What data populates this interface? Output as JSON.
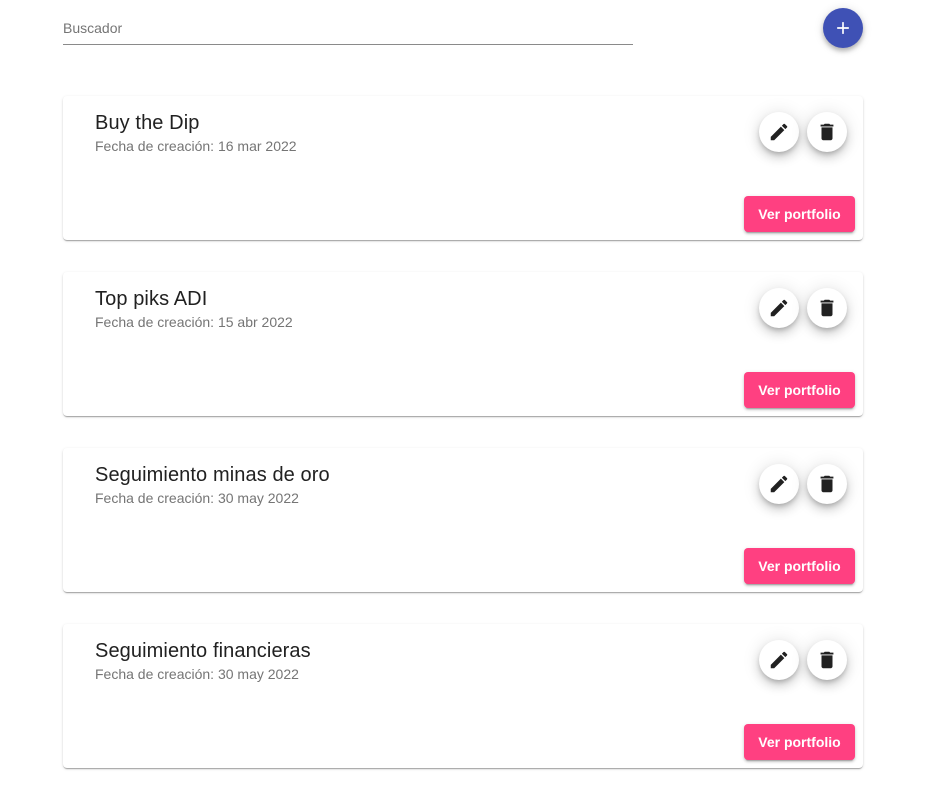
{
  "search": {
    "placeholder": "Buscador",
    "value": ""
  },
  "fab": {
    "icon": "plus-icon",
    "color": "#3f51b5"
  },
  "colors": {
    "accent": "#ff4081",
    "primary": "#3f51b5"
  },
  "portfolios": [
    {
      "title": "Buy the Dip",
      "created": "Fecha de creación: 16 mar 2022",
      "action_label": "Ver portfolio"
    },
    {
      "title": "Top piks ADI",
      "created": "Fecha de creación: 15 abr 2022",
      "action_label": "Ver portfolio"
    },
    {
      "title": "Seguimiento minas de oro",
      "created": "Fecha de creación: 30 may 2022",
      "action_label": "Ver portfolio"
    },
    {
      "title": "Seguimiento financieras",
      "created": "Fecha de creación: 30 may 2022",
      "action_label": "Ver portfolio"
    }
  ]
}
